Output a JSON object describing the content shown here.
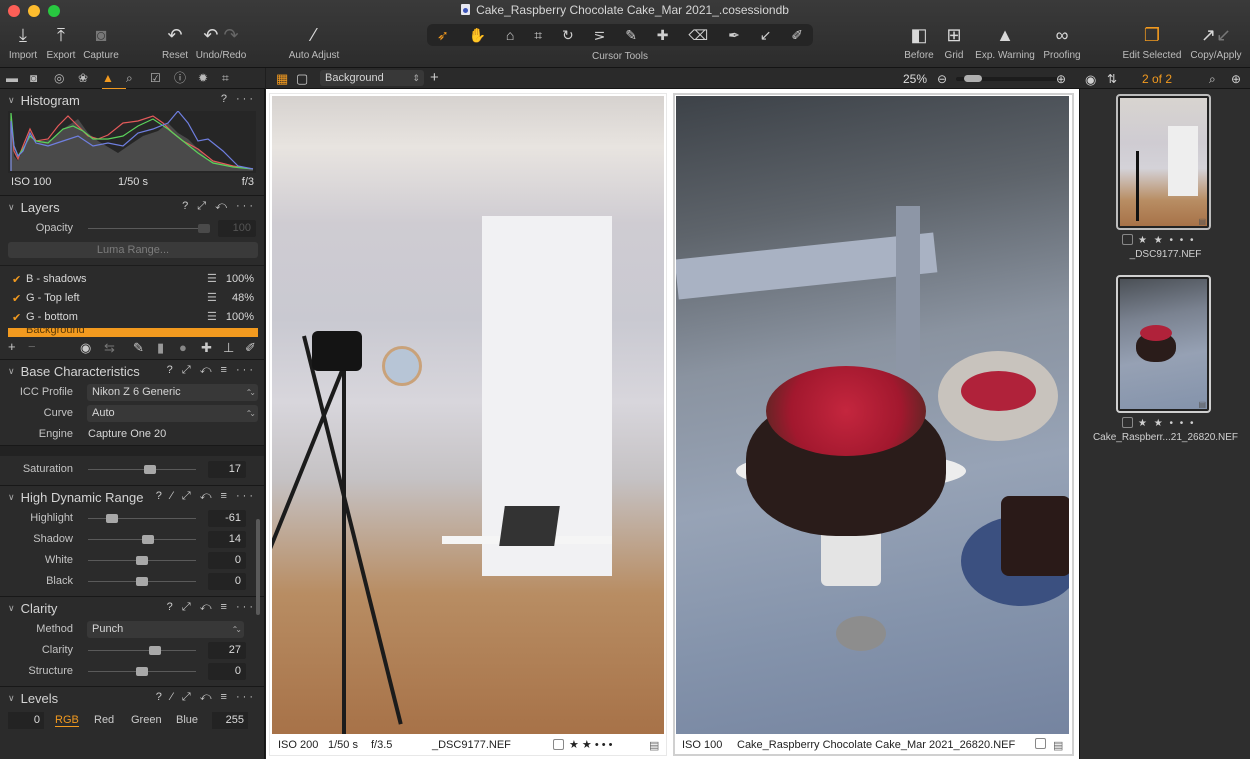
{
  "window": {
    "title": "Cake_Raspberry Chocolate Cake_Mar 2021_.cosessiondb",
    "traffic_lights": {
      "close": "#fc5f57",
      "minimize": "#fdbc2e",
      "maximize": "#28c840"
    }
  },
  "toolbar": {
    "left_buttons": [
      {
        "label": "Import",
        "icon": "import-icon"
      },
      {
        "label": "Export",
        "icon": "export-icon"
      },
      {
        "label": "Capture",
        "icon": "camera-icon"
      },
      {
        "label": "Reset",
        "icon": "reset-icon"
      },
      {
        "label": "Undo/Redo",
        "icon": "undo-redo-icon"
      },
      {
        "label": "Auto Adjust",
        "icon": "magic-wand-icon"
      }
    ],
    "cursor_tools_label": "Cursor Tools",
    "cursor_tools": [
      "select-arrow-icon",
      "pan-hand-icon",
      "loupe-icon",
      "crop-icon",
      "rotate-icon",
      "keystone-icon",
      "brush-icon",
      "heal-icon",
      "eraser-icon",
      "picker-icon",
      "gradient-icon",
      "annotate-icon"
    ],
    "right_buttons": [
      {
        "label": "Before",
        "icon": "before-icon"
      },
      {
        "label": "Grid",
        "icon": "grid-icon"
      },
      {
        "label": "Exp. Warning",
        "icon": "warning-icon"
      },
      {
        "label": "Proofing",
        "icon": "glasses-icon"
      },
      {
        "label": "Edit Selected",
        "icon": "edit-selected-icon"
      },
      {
        "label": "Copy/Apply",
        "icon": "copy-apply-icon"
      }
    ],
    "accent": "#f29a1f"
  },
  "tool_tabs": [
    "library",
    "capture",
    "lens",
    "color",
    "exposure",
    "details",
    "adjustments",
    "metadata",
    "output",
    "crop"
  ],
  "viewer_bar": {
    "layer_select": "Background",
    "zoom": "25%",
    "zoom_slider_fraction": 0.08
  },
  "browser_bar": {
    "count": "2 of 2"
  },
  "histogram": {
    "title": "Histogram",
    "iso": "ISO 100",
    "shutter": "1/50 s",
    "aperture": "f/3"
  },
  "layers": {
    "title": "Layers",
    "opacity_label": "Opacity",
    "opacity_value": "100",
    "luma_range": "Luma Range...",
    "items": [
      {
        "name": "B - shadows",
        "checked": true,
        "opacity": "100%"
      },
      {
        "name": "G - Top left",
        "checked": true,
        "opacity": "48%"
      },
      {
        "name": "G - bottom",
        "checked": true,
        "opacity": "100%"
      },
      {
        "name": "Background",
        "selected": true
      }
    ]
  },
  "base_characteristics": {
    "title": "Base Characteristics",
    "icc_label": "ICC Profile",
    "icc_value": "Nikon Z 6 Generic",
    "curve_label": "Curve",
    "curve_value": "Auto",
    "engine_label": "Engine",
    "engine_value": "Capture One 20"
  },
  "saturation": {
    "label": "Saturation",
    "value": "17",
    "fraction": 0.57
  },
  "hdr": {
    "title": "High Dynamic Range",
    "rows": [
      {
        "label": "Highlight",
        "value": "-61",
        "fraction": 0.22
      },
      {
        "label": "Shadow",
        "value": "14",
        "fraction": 0.56
      },
      {
        "label": "White",
        "value": "0",
        "fraction": 0.5
      },
      {
        "label": "Black",
        "value": "0",
        "fraction": 0.5
      }
    ]
  },
  "clarity": {
    "title": "Clarity",
    "method_label": "Method",
    "method_value": "Punch",
    "rows": [
      {
        "label": "Clarity",
        "value": "27",
        "fraction": 0.62
      },
      {
        "label": "Structure",
        "value": "0",
        "fraction": 0.5
      }
    ]
  },
  "levels": {
    "title": "Levels",
    "low": "0",
    "high": "255",
    "channels": [
      "RGB",
      "Red",
      "Green",
      "Blue"
    ],
    "active_channel": "RGB"
  },
  "viewer": {
    "left": {
      "iso": "ISO 200",
      "shutter": "1/50 s",
      "aperture": "f/3.5",
      "file": "_DSC9177.NEF",
      "rating": 2
    },
    "right": {
      "iso": "ISO 100",
      "file": "Cake_Raspberry Chocolate Cake_Mar 2021_26820.NEF"
    }
  },
  "thumbnails": [
    {
      "name": "_DSC9177.NEF",
      "rating": 2
    },
    {
      "name": "Cake_Raspberr...21_26820.NEF",
      "rating": 2
    }
  ],
  "rating_glyphs": {
    "star": "★",
    "empty": "•"
  }
}
